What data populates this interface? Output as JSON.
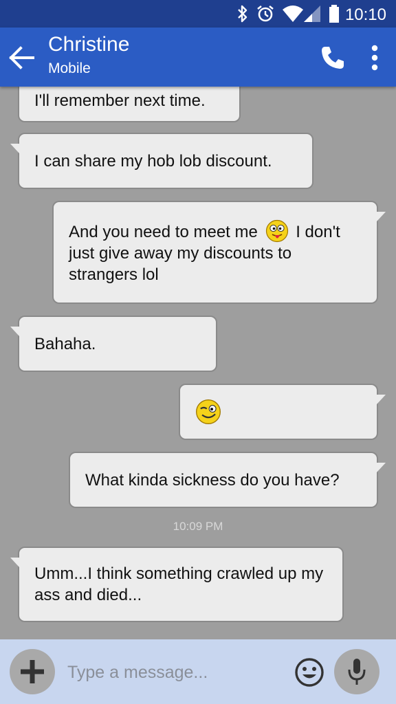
{
  "status_bar": {
    "time": "10:10",
    "icons": [
      "bluetooth-icon",
      "alarm-icon",
      "wifi-icon",
      "signal-icon",
      "battery-icon"
    ]
  },
  "header": {
    "contact_name": "Christine",
    "contact_subtitle": "Mobile",
    "icons": [
      "back-arrow-icon",
      "phone-icon",
      "more-vert-icon"
    ],
    "bar_color": "#2b5cc4"
  },
  "messages": [
    {
      "direction": "incoming",
      "text": "I'll remember next time."
    },
    {
      "direction": "incoming",
      "text": "I can share my hob lob discount."
    },
    {
      "direction": "outgoing",
      "text_before": "And you need to meet me",
      "emoji": "tongue-out-emoji",
      "text_after": "I don't just give away my discounts to strangers lol"
    },
    {
      "direction": "incoming",
      "text": "Bahaha."
    },
    {
      "direction": "outgoing",
      "emoji": "wink-emoji"
    },
    {
      "direction": "outgoing",
      "text": "What kinda sickness do you have?"
    },
    {
      "direction": "incoming",
      "text": "Umm...I think something crawled up my ass and died..."
    }
  ],
  "timestamp": "10:09 PM",
  "composer": {
    "placeholder": "Type a message...",
    "icons": [
      "plus-icon",
      "smiley-icon",
      "microphone-icon"
    ],
    "background": "#c8d6ef"
  }
}
